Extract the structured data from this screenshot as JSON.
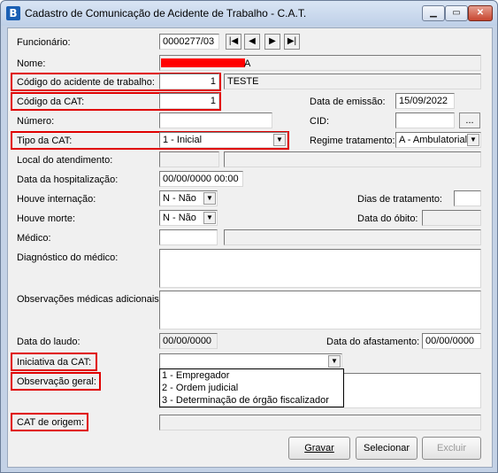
{
  "window": {
    "app_icon_letter": "B",
    "title": "Cadastro de Comunicação de Acidente de Trabalho - C.A.T.",
    "min_glyph": "▁",
    "max_glyph": "▭",
    "close_glyph": "✕"
  },
  "nav": {
    "first": "|◀",
    "prev": "◀",
    "next": "▶",
    "last": "▶|"
  },
  "form": {
    "funcionario": {
      "label": "Funcionário:",
      "value": "0000277/03"
    },
    "nome": {
      "label": "Nome:",
      "value": "",
      "visible_suffix": "A"
    },
    "codigo_acidente": {
      "label": "Código do acidente de trabalho:",
      "value": "1",
      "description": "TESTE"
    },
    "codigo_cat": {
      "label": "Código da CAT:",
      "value": "1"
    },
    "data_emissao": {
      "label": "Data de emissão:",
      "value": "15/09/2022"
    },
    "numero": {
      "label": "Número:",
      "value": ""
    },
    "cid": {
      "label": "CID:",
      "value": "",
      "button": "..."
    },
    "tipo_cat": {
      "label": "Tipo da CAT:",
      "value": "1 - Inicial"
    },
    "regime_tratamento": {
      "label": "Regime tratamento:",
      "value": "A - Ambulatorial"
    },
    "local_atendimento": {
      "label": "Local do atendimento:",
      "value": ""
    },
    "data_hospitalizacao": {
      "label": "Data da hospitalização:",
      "value": "00/00/0000 00:00"
    },
    "houve_internacao": {
      "label": "Houve internação:",
      "value": "N - Não"
    },
    "dias_tratamento": {
      "label": "Dias de tratamento:",
      "value": ""
    },
    "houve_morte": {
      "label": "Houve morte:",
      "value": "N - Não"
    },
    "data_obito": {
      "label": "Data do óbito:",
      "value": ""
    },
    "medico": {
      "label": "Médico:",
      "value": ""
    },
    "diagnostico": {
      "label": "Diagnóstico do médico:",
      "value": ""
    },
    "observacoes_medicas": {
      "label": "Observações médicas adicionais:",
      "value": ""
    },
    "data_laudo": {
      "label": "Data do laudo:",
      "value": "00/00/0000"
    },
    "data_afastamento": {
      "label": "Data do afastamento:",
      "value": "00/00/0000"
    },
    "iniciativa_cat": {
      "label": "Iniciativa da CAT:",
      "value": "",
      "options": [
        "1 - Empregador",
        "2 - Ordem judicial",
        "3 - Determinação de órgão fiscalizador"
      ]
    },
    "observacao_geral": {
      "label": "Observação geral:",
      "value": ""
    },
    "cat_origem": {
      "label": "CAT de origem:",
      "value": ""
    }
  },
  "buttons": {
    "gravar": "Gravar",
    "selecionar": "Selecionar",
    "excluir": "Excluir"
  },
  "colors": {
    "highlight": "#e00000",
    "redaction": "#ff0000"
  }
}
